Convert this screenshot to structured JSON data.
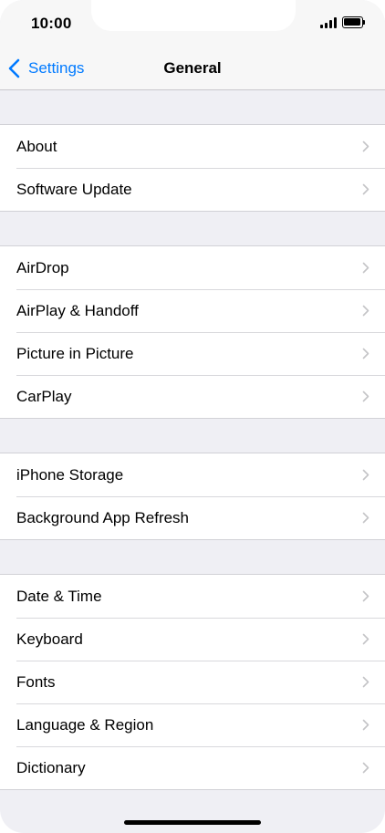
{
  "status_bar": {
    "time": "10:00",
    "icons": [
      "signal-icon",
      "battery-icon"
    ]
  },
  "nav": {
    "back_label": "Settings",
    "back_icon": "chevron-left-icon",
    "title": "General"
  },
  "colors": {
    "accent": "#007aff",
    "background": "#efeff4",
    "cell": "#ffffff",
    "separator": "#d1d1d6",
    "chevron": "#c4c4c7"
  },
  "groups": [
    {
      "items": [
        {
          "label": "About"
        },
        {
          "label": "Software Update"
        }
      ]
    },
    {
      "items": [
        {
          "label": "AirDrop"
        },
        {
          "label": "AirPlay & Handoff"
        },
        {
          "label": "Picture in Picture"
        },
        {
          "label": "CarPlay"
        }
      ]
    },
    {
      "items": [
        {
          "label": "iPhone Storage"
        },
        {
          "label": "Background App Refresh"
        }
      ]
    },
    {
      "items": [
        {
          "label": "Date & Time"
        },
        {
          "label": "Keyboard"
        },
        {
          "label": "Fonts"
        },
        {
          "label": "Language & Region"
        },
        {
          "label": "Dictionary"
        }
      ]
    }
  ]
}
